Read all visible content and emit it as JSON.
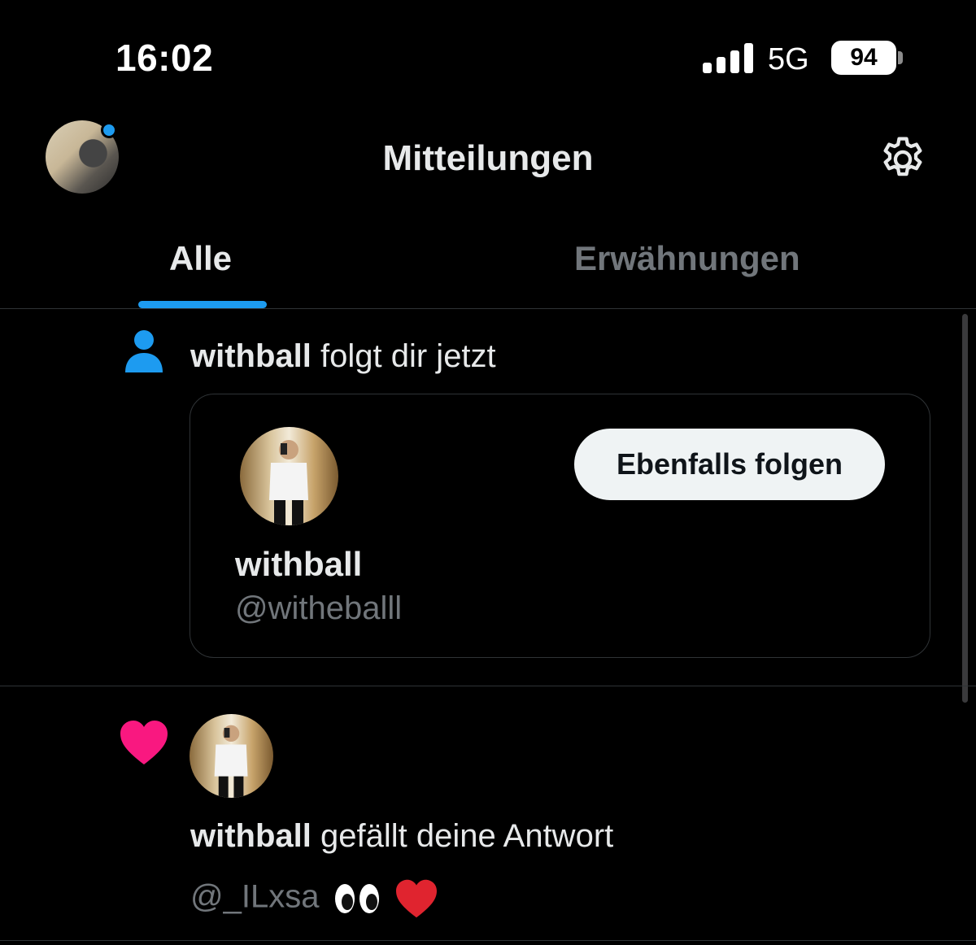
{
  "status_bar": {
    "time": "16:02",
    "network": "5G",
    "battery": "94"
  },
  "header": {
    "title": "Mitteilungen"
  },
  "tabs": [
    {
      "label": "Alle",
      "active": true
    },
    {
      "label": "Erwähnungen",
      "active": false
    }
  ],
  "notifications": [
    {
      "type": "follow",
      "icon": "person-icon",
      "user": "withball",
      "action": "folgt dir jetzt",
      "card": {
        "display_name": "withball",
        "handle": "@witheballl",
        "follow_button_label": "Ebenfalls folgen"
      }
    },
    {
      "type": "like",
      "icon": "heart-icon",
      "user": "withball",
      "action": "gefällt deine Antwort",
      "reply_text": "@_ILxsa"
    }
  ],
  "colors": {
    "accent": "#1d9bf0",
    "like": "#f91880",
    "background": "#000000",
    "muted_text": "#71767b"
  }
}
